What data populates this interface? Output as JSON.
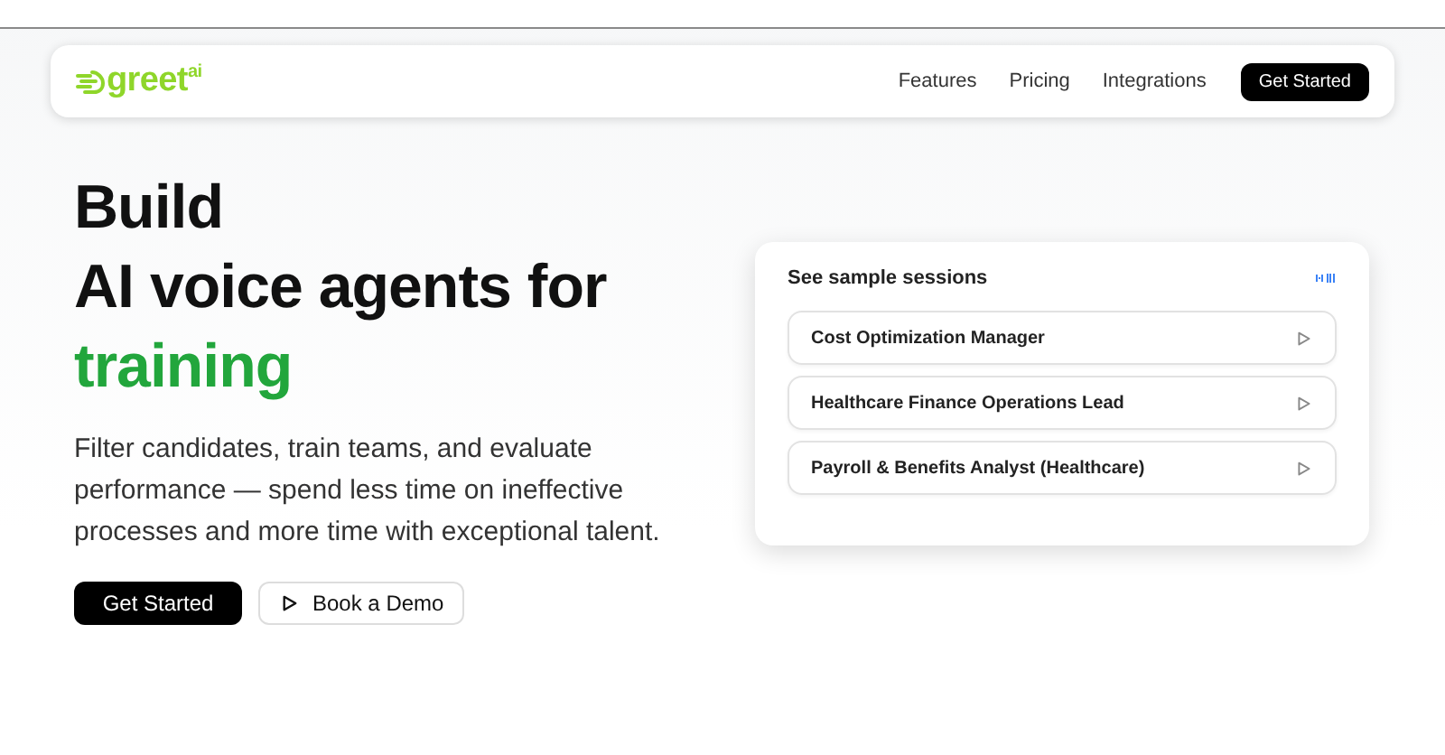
{
  "nav": {
    "logo": "greet$^{ai}$",
    "links": [
      "Features",
      "Pricing",
      "Integrations"
    ],
    "cta": "Get Started"
  },
  "hero": {
    "lines": [
      {
        "text": "Build",
        "accent": false
      },
      {
        "text": "AI voice agents for",
        "accent": false
      },
      {
        "text": "training",
        "accent": true
      }
    ],
    "description": "Filter candidates, train teams, and evaluate performance — spend less time on ineffective processes and more time with exceptional talent.",
    "primary_button": "Get Started",
    "secondary_button": "Book a Demo"
  },
  "sessions": {
    "title": "See sample sessions",
    "items": [
      {
        "label": "Cost Optimization Manager"
      },
      {
        "label": "Healthcare Finance Operations Lead"
      },
      {
        "label": "Payroll & Benefits Analyst (Healthcare)"
      }
    ]
  }
}
